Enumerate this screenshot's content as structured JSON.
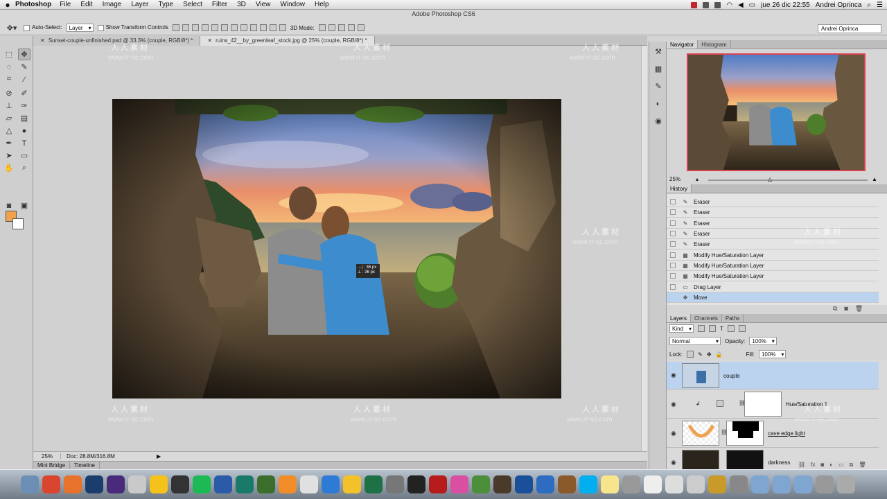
{
  "menubar": {
    "apple": "",
    "app_name": "Photoshop",
    "items": [
      "File",
      "Edit",
      "Image",
      "Layer",
      "Type",
      "Select",
      "Filter",
      "3D",
      "View",
      "Window",
      "Help"
    ],
    "clock": "jue 26 dic  22:55",
    "user": "Andrei Oprinca"
  },
  "window_title": "Adobe Photoshop CS6",
  "options": {
    "auto_select_label": "Auto-Select:",
    "auto_select_value": "Layer",
    "transform_label": "Show Transform Controls",
    "mode_3d_label": "3D Mode:",
    "workspace": "Andrei Oprinca"
  },
  "tabs": [
    {
      "label": "Sunset-couple-unfinished.psd @ 33.3% (couple, RGB/8*) *"
    },
    {
      "label": "ruins_42__by_greenleaf_stock.jpg @ 25% (couple, RGB/8*) *"
    }
  ],
  "canvas": {
    "tooltip_x": "→| : 36 px",
    "tooltip_y": "⊥ : 36 px"
  },
  "status": {
    "zoom": "25%",
    "doc": "Doc: 28.8M/316.8M"
  },
  "bottom_tabs": [
    "Mini Bridge",
    "Timeline"
  ],
  "navigator": {
    "tabs": [
      "Navigator",
      "Histogram"
    ],
    "zoom": "25%"
  },
  "history": {
    "tab": "History",
    "items": [
      "Eraser",
      "Eraser",
      "Eraser",
      "Eraser",
      "Eraser",
      "Modify Hue/Saturation Layer",
      "Modify Hue/Saturation Layer",
      "Modify Hue/Saturation Layer",
      "Drag Layer",
      "Move"
    ],
    "current_index": 9
  },
  "layers_panel": {
    "tabs": [
      "Layers",
      "Channels",
      "Paths"
    ],
    "kind": "Kind",
    "blend_mode": "Normal",
    "opacity_label": "Opacity:",
    "opacity": "100%",
    "lock_label": "Lock:",
    "fill_label": "Fill:",
    "fill": "100%",
    "layers": [
      {
        "name": "couple",
        "selected": true
      },
      {
        "name": "Hue/Saturation 1",
        "selected": false
      },
      {
        "name": "cave edge light",
        "selected": false
      },
      {
        "name": "darkness",
        "selected": false
      }
    ]
  },
  "watermark": {
    "cn": "人人素材",
    "url": "www.rr-sc.com"
  },
  "dock": [
    "Finder",
    "Chrome",
    "Firefox",
    "Ps",
    "Ae",
    "Cal",
    "Norton",
    "Steam",
    "Spotify",
    "W",
    "Au",
    "Dw",
    "VLC",
    "Pages",
    "Safari",
    "Drive",
    "Excel",
    "Utility",
    "Terminal",
    "FileZilla",
    "iTunes",
    "Gif",
    "Lr",
    "GoPro",
    "Teamviewer",
    "Archive",
    "Skype",
    "Notes",
    "Calc",
    "TextEdit",
    "Script",
    "Font",
    "USB",
    "Disk",
    "Folder",
    "Folder",
    "Folder",
    "Help",
    "Trash"
  ],
  "colors": {
    "foreground": "#f0a14d",
    "background": "#ffffff",
    "nav_frame": "#d94150",
    "selected_row": "#bcd3ef"
  }
}
